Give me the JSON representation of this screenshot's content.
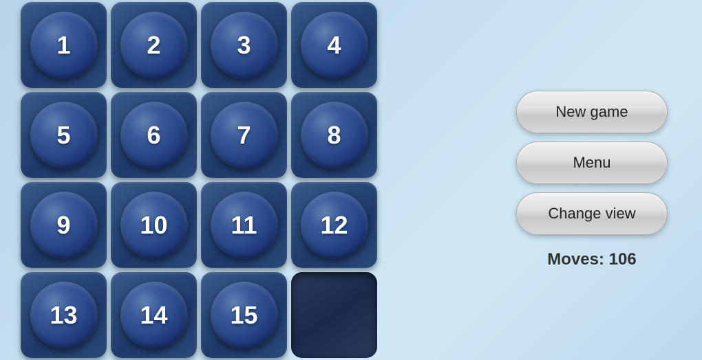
{
  "buttons": {
    "new_game": "New game",
    "menu": "Menu",
    "change_view": "Change view"
  },
  "moves_label": "Moves: 106",
  "tiles": [
    {
      "number": "1",
      "empty": false
    },
    {
      "number": "2",
      "empty": false
    },
    {
      "number": "3",
      "empty": false
    },
    {
      "number": "4",
      "empty": false
    },
    {
      "number": "5",
      "empty": false
    },
    {
      "number": "6",
      "empty": false
    },
    {
      "number": "7",
      "empty": false
    },
    {
      "number": "8",
      "empty": false
    },
    {
      "number": "9",
      "empty": false
    },
    {
      "number": "10",
      "empty": false
    },
    {
      "number": "11",
      "empty": false
    },
    {
      "number": "12",
      "empty": false
    },
    {
      "number": "13",
      "empty": false
    },
    {
      "number": "14",
      "empty": false
    },
    {
      "number": "15",
      "empty": false
    },
    {
      "number": "",
      "empty": true
    }
  ]
}
